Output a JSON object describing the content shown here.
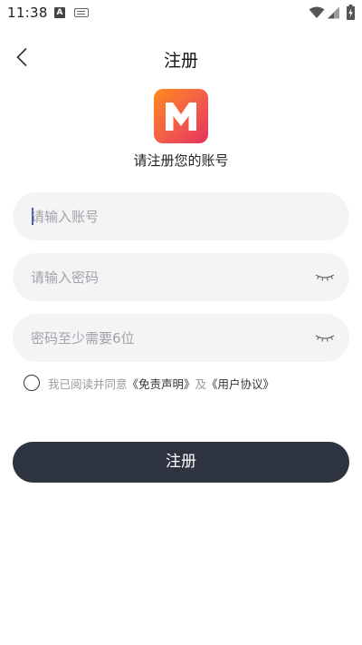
{
  "status_bar": {
    "time": "11:38",
    "icons": [
      "android-notification-icon",
      "keyboard-icon",
      "wifi-icon",
      "signal-icon",
      "battery-charging-icon"
    ]
  },
  "header": {
    "title": "注册",
    "back_icon": "chevron-left-icon"
  },
  "logo": {
    "letter": "M",
    "gradient": [
      "#ff8a1c",
      "#f25c4a",
      "#e6325e"
    ]
  },
  "subtitle": "请注册您的账号",
  "form": {
    "account": {
      "value": "",
      "placeholder": "请输入账号"
    },
    "password": {
      "value": "",
      "placeholder": "请输入密码",
      "toggle_icon": "eye-closed-icon"
    },
    "confirm": {
      "value": "",
      "placeholder": "密码至少需要6位",
      "toggle_icon": "eye-closed-icon"
    }
  },
  "agreement": {
    "checked": false,
    "prefix": "我已阅读并同意",
    "disclaimer": "《免责声明》",
    "connector": "及",
    "user_agreement": "《用户协议》"
  },
  "submit_label": "注册",
  "colors": {
    "button_bg": "#2e3340",
    "field_bg": "#f4f4f6",
    "placeholder": "#a3a3a8",
    "caret": "#3b5bb5"
  }
}
